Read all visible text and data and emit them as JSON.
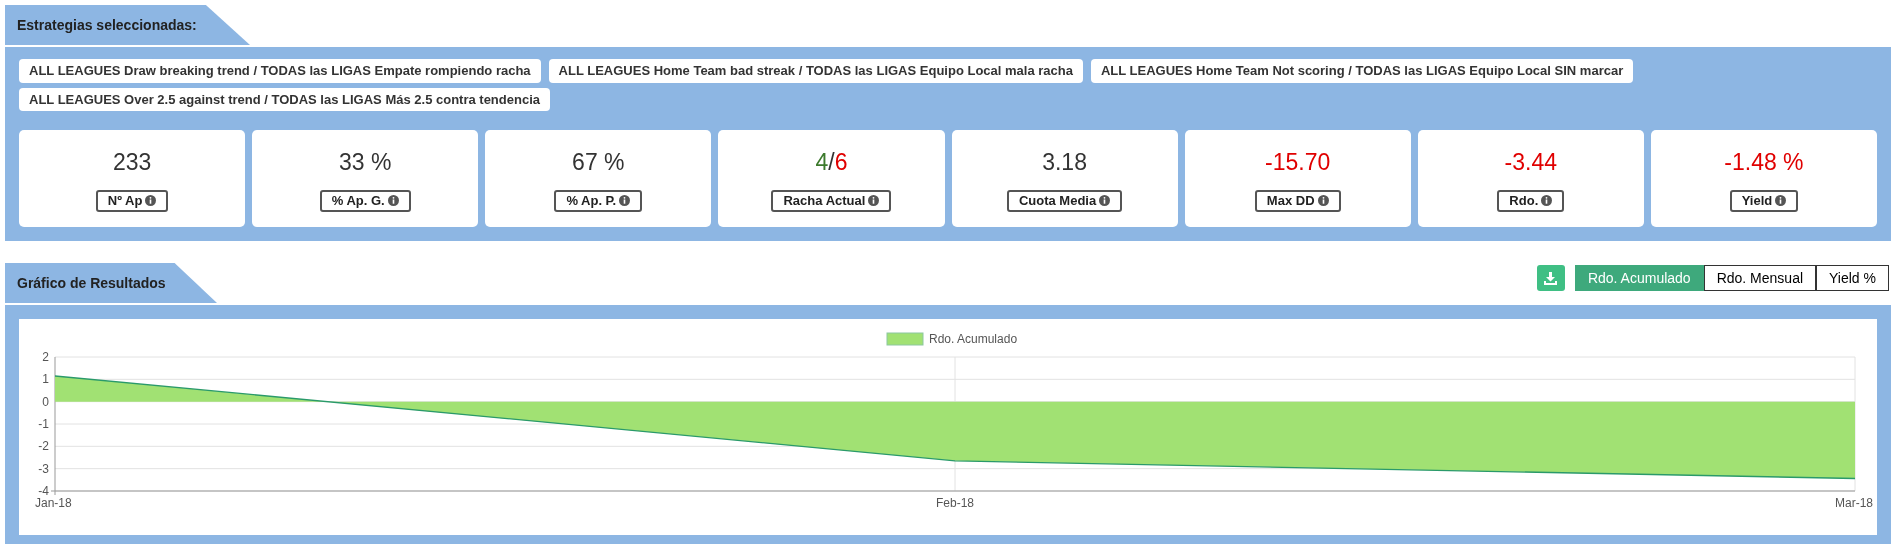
{
  "strategies_section": {
    "title": "Estrategias seleccionadas:",
    "strategies": [
      "ALL LEAGUES Draw breaking trend / TODAS las LIGAS Empate rompiendo racha",
      "ALL LEAGUES Home Team bad streak / TODAS las LIGAS Equipo Local mala racha",
      "ALL LEAGUES Home Team Not scoring / TODAS las LIGAS Equipo Local SIN marcar",
      "ALL LEAGUES Over 2.5 against trend / TODAS las LIGAS Más 2.5 contra tendencia"
    ],
    "stats": [
      {
        "label": "Nº Ap",
        "value_parts": [
          {
            "text": "233",
            "color": "#333333"
          }
        ]
      },
      {
        "label": "% Ap. G.",
        "value_parts": [
          {
            "text": "33 %",
            "color": "#333333"
          }
        ]
      },
      {
        "label": "% Ap. P.",
        "value_parts": [
          {
            "text": "67 %",
            "color": "#333333"
          }
        ]
      },
      {
        "label": "Racha Actual",
        "value_parts": [
          {
            "text": "4",
            "color": "#3c7a2c"
          },
          {
            "text": "/",
            "color": "#333333"
          },
          {
            "text": "6",
            "color": "#e00000"
          }
        ]
      },
      {
        "label": "Cuota Media",
        "value_parts": [
          {
            "text": "3.18",
            "color": "#333333"
          }
        ]
      },
      {
        "label": "Max DD",
        "value_parts": [
          {
            "text": "-15.70",
            "color": "#e00000"
          }
        ]
      },
      {
        "label": "Rdo.",
        "value_parts": [
          {
            "text": "-3.44",
            "color": "#e00000"
          }
        ]
      },
      {
        "label": "Yield",
        "value_parts": [
          {
            "text": "-1.48 %",
            "color": "#e00000"
          }
        ]
      }
    ]
  },
  "results_section": {
    "title": "Gráfico de Resultados",
    "view_buttons": [
      {
        "label": "Rdo. Acumulado",
        "selected": true
      },
      {
        "label": "Rdo. Mensual",
        "selected": false
      },
      {
        "label": "Yield %",
        "selected": false
      }
    ],
    "chart_data": {
      "type": "area",
      "categories": [
        "Jan-18",
        "Feb-18",
        "Mar-18"
      ],
      "series": [
        {
          "name": "Rdo. Acumulado",
          "color": "#a1e173",
          "values": [
            1.15,
            -2.65,
            -3.44
          ]
        }
      ],
      "ylim": [
        -4,
        2
      ],
      "yticks": [
        2,
        1,
        0,
        -1,
        -2,
        -3,
        -4
      ],
      "grid": true
    }
  }
}
